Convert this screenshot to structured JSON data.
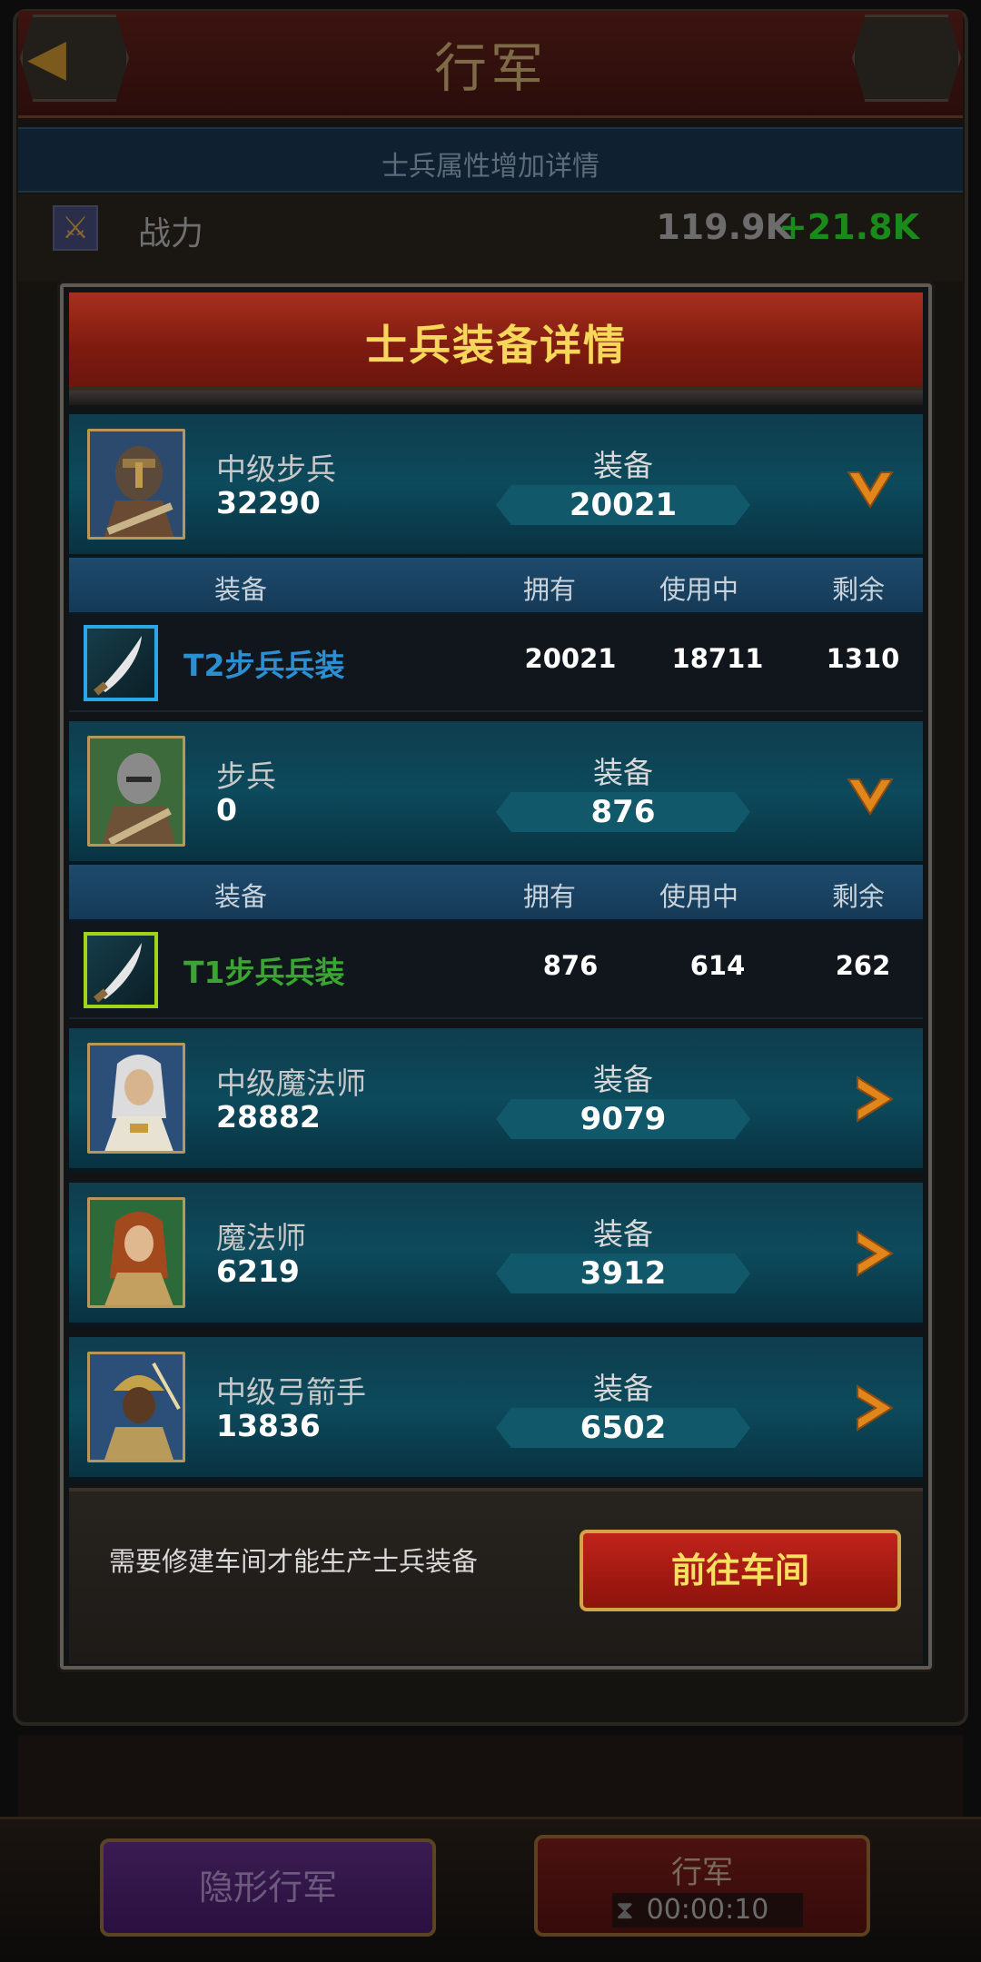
{
  "screen": {
    "title": "行军",
    "subheader": "士兵属性增加详情",
    "power_label": "战力",
    "power_value": "119.9K",
    "power_delta": "+21.8K"
  },
  "modal": {
    "title": "士兵装备详情",
    "equip_label": "装备",
    "columns": {
      "gear": "装备",
      "owned": "拥有",
      "in_use": "使用中",
      "remaining": "剩余"
    },
    "units": [
      {
        "name": "中级步兵",
        "count": "32290",
        "equip": "20021",
        "expanded": true
      },
      {
        "name": "步兵",
        "count": "0",
        "equip": "876",
        "expanded": true
      },
      {
        "name": "中级魔法师",
        "count": "28882",
        "equip": "9079",
        "expanded": false
      },
      {
        "name": "魔法师",
        "count": "6219",
        "equip": "3912",
        "expanded": false
      },
      {
        "name": "中级弓箭手",
        "count": "13836",
        "equip": "6502",
        "expanded": false
      }
    ],
    "gear_rows": [
      {
        "name": "T2步兵兵装",
        "owned": "20021",
        "in_use": "18711",
        "remaining": "1310",
        "color": "#2b8fd4"
      },
      {
        "name": "T1步兵兵装",
        "owned": "876",
        "in_use": "614",
        "remaining": "262",
        "color": "#3aa532"
      }
    ],
    "footer_note": "需要修建车间才能生产士兵装备",
    "workshop_button": "前往车间"
  },
  "bottom": {
    "stealth_button": "隐形行军",
    "march_button": "行军",
    "march_timer": "00:00:10"
  }
}
